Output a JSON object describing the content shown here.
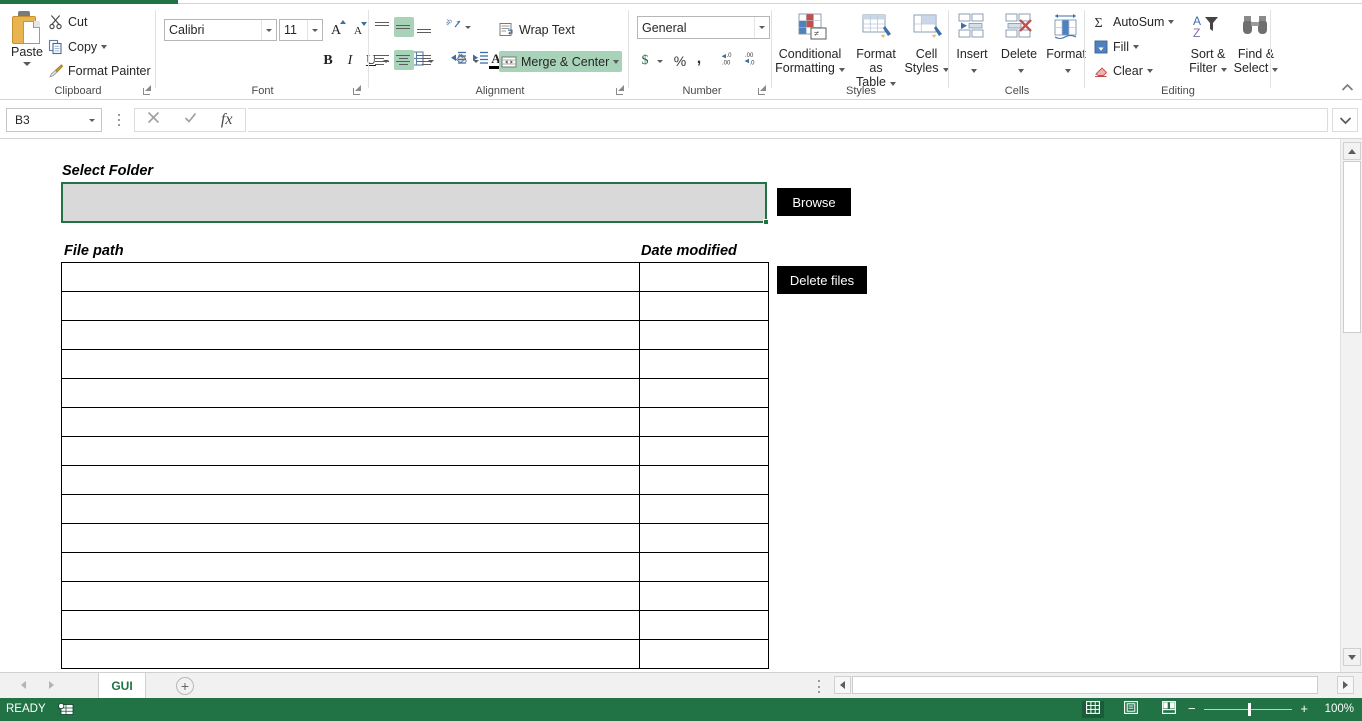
{
  "app": {
    "accent_color": "#217346",
    "button_color": "#000000",
    "selected_cell_fill": "#d9d9d9"
  },
  "ribbon": {
    "collapse_icon": "chevron-up-icon",
    "groups": [
      {
        "name": "clipboard",
        "label": "Clipboard",
        "paste_label": "Paste",
        "items": [
          {
            "label": "Cut",
            "icon": "scissors-icon"
          },
          {
            "label": "Copy",
            "icon": "copy-icon"
          },
          {
            "label": "Format Painter",
            "icon": "paintbrush-icon"
          }
        ]
      },
      {
        "name": "font",
        "label": "Font",
        "font_name": "Calibri",
        "font_size": "11",
        "grow_font_label": "A",
        "shrink_font_label": "A",
        "bold_label": "B",
        "italic_label": "I",
        "underline_label": "U",
        "borders_icon": "borders-icon",
        "fill_color_icon": "fill-color-icon",
        "font_color_icon": "font-color-icon"
      },
      {
        "name": "alignment",
        "label": "Alignment",
        "wrap_text_label": "Wrap Text",
        "merge_center_label": "Merge & Center",
        "orientation_icon": "text-orientation-icon",
        "decrease_indent_icon": "decrease-indent-icon",
        "increase_indent_icon": "increase-indent-icon",
        "active": [
          "align-middle",
          "align-center"
        ]
      },
      {
        "name": "number",
        "label": "Number",
        "format_value": "General",
        "currency_label": "$",
        "percent_label": "%",
        "comma_label": ",",
        "decrease_decimal_icon": "decrease-decimal-icon",
        "increase_decimal_icon": "increase-decimal-icon"
      },
      {
        "name": "styles",
        "label": "Styles",
        "items": [
          {
            "label_line1": "Conditional",
            "label_line2": "Formatting",
            "icon": "conditional-formatting-icon"
          },
          {
            "label_line1": "Format as",
            "label_line2": "Table",
            "icon": "format-as-table-icon"
          },
          {
            "label_line1": "Cell",
            "label_line2": "Styles",
            "icon": "cell-styles-icon"
          }
        ]
      },
      {
        "name": "cells",
        "label": "Cells",
        "items": [
          {
            "label_line1": "Insert",
            "icon": "insert-cells-icon"
          },
          {
            "label_line1": "Delete",
            "icon": "delete-cells-icon"
          },
          {
            "label_line1": "Format",
            "icon": "format-cells-icon"
          }
        ]
      },
      {
        "name": "editing",
        "label": "Editing",
        "autosum_label": "AutoSum",
        "fill_label": "Fill",
        "clear_label": "Clear",
        "sort_filter_line1": "Sort &",
        "sort_filter_line2": "Filter",
        "find_select_line1": "Find &",
        "find_select_line2": "Select",
        "autosum_icon": "sigma-icon",
        "fill_icon": "fill-down-icon",
        "clear_icon": "eraser-icon",
        "sort_filter_icon": "sort-filter-icon",
        "find_select_icon": "binoculars-icon"
      }
    ]
  },
  "formula_bar": {
    "name_box_value": "B3",
    "name_box_dropdown_icon": "chevron-down-icon",
    "cancel_icon": "cancel-x-icon",
    "enter_icon": "check-icon",
    "insert_function_icon": "fx-icon",
    "formula_value": "",
    "expand_icon": "chevron-down-icon"
  },
  "worksheet": {
    "select_folder_label": "Select Folder",
    "folder_path_value": "",
    "browse_button": "Browse",
    "delete_button": "Delete files",
    "columns": [
      "File path",
      "Date modified"
    ],
    "rows": [
      {
        "file_path": "",
        "date_modified": ""
      },
      {
        "file_path": "",
        "date_modified": ""
      },
      {
        "file_path": "",
        "date_modified": ""
      },
      {
        "file_path": "",
        "date_modified": ""
      },
      {
        "file_path": "",
        "date_modified": ""
      },
      {
        "file_path": "",
        "date_modified": ""
      },
      {
        "file_path": "",
        "date_modified": ""
      },
      {
        "file_path": "",
        "date_modified": ""
      },
      {
        "file_path": "",
        "date_modified": ""
      },
      {
        "file_path": "",
        "date_modified": ""
      },
      {
        "file_path": "",
        "date_modified": ""
      },
      {
        "file_path": "",
        "date_modified": ""
      },
      {
        "file_path": "",
        "date_modified": ""
      },
      {
        "file_path": "",
        "date_modified": ""
      }
    ]
  },
  "tab_bar": {
    "prev_sheet_icon": "triangle-left-icon",
    "next_sheet_icon": "triangle-right-icon",
    "sheets": [
      {
        "name": "GUI",
        "active": true
      }
    ],
    "add_sheet_label": "+"
  },
  "status_bar": {
    "status_text": "READY",
    "macro_record_icon": "macro-record-icon",
    "views": [
      {
        "name": "normal-view",
        "icon": "grid-icon",
        "active": true
      },
      {
        "name": "page-layout-view",
        "icon": "page-layout-icon",
        "active": false
      },
      {
        "name": "page-break-view",
        "icon": "page-break-icon",
        "active": false
      }
    ],
    "zoom_out_label": "−",
    "zoom_in_label": "+",
    "zoom_level": "100%"
  }
}
